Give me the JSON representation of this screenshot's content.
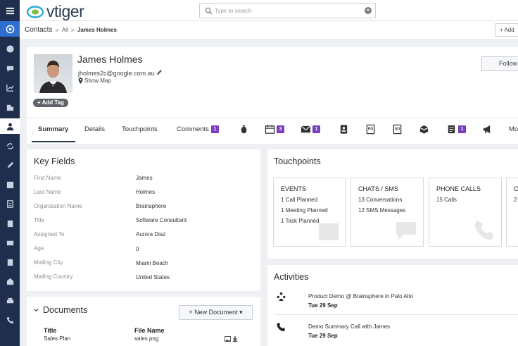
{
  "brand": {
    "name": "vtiger"
  },
  "search": {
    "placeholder": "Type to search"
  },
  "breadcrumb": {
    "module": "Contacts",
    "sep1": ">",
    "list": "All",
    "sep2": ">",
    "record": "James Holmes"
  },
  "toolbar": {
    "add_label": "+ Add"
  },
  "record": {
    "name": "James Holmes",
    "email": "jholmes2c@google.com.au",
    "show_map": "Show Map",
    "add_tag": "+ Add Tag",
    "follow": "Follow"
  },
  "tabs": [
    {
      "label": "Summary",
      "active": true
    },
    {
      "label": "Details"
    },
    {
      "label": "Touchpoints"
    },
    {
      "label": "Comments",
      "badge": "1"
    }
  ],
  "tab_icons": [
    {
      "icon": "money-bag-icon"
    },
    {
      "icon": "calendar-icon",
      "badge": "3"
    },
    {
      "icon": "envelope-icon",
      "badge": "1"
    },
    {
      "icon": "contact-card-icon"
    },
    {
      "icon": "purchase-order-icon",
      "text": "PO"
    },
    {
      "icon": "sales-order-icon",
      "text": "SO"
    },
    {
      "icon": "box-icon"
    },
    {
      "icon": "document-icon",
      "badge": "1"
    },
    {
      "icon": "megaphone-icon"
    }
  ],
  "more_tab": "Mo",
  "key_fields": {
    "title": "Key Fields",
    "rows": [
      {
        "label": "First Name",
        "value": "James"
      },
      {
        "label": "Last Name",
        "value": "Holmes"
      },
      {
        "label": "Organization Name",
        "value": "Brainsphere"
      },
      {
        "label": "Title",
        "value": "Software Consultant"
      },
      {
        "label": "Assigned To",
        "value": "Aurora Diaz"
      },
      {
        "label": "Age",
        "value": "0"
      },
      {
        "label": "Mailing City",
        "value": "Miami Beach"
      },
      {
        "label": "Mailing Country",
        "value": "United States"
      }
    ]
  },
  "touchpoints": {
    "title": "Touchpoints",
    "cards": [
      {
        "head": "EVENTS",
        "rows": [
          "1 Call Planned",
          "1 Meeting Planned",
          "1 Task Planned"
        ]
      },
      {
        "head": "CHATS / SMS",
        "rows": [
          "13  Conversations",
          "12  SMS Messages"
        ]
      },
      {
        "head": "PHONE CALLS",
        "rows": [
          "15  Calls"
        ]
      },
      {
        "head": "C",
        "rows": [
          "2"
        ]
      }
    ]
  },
  "activities": {
    "title": "Activities",
    "items": [
      {
        "icon": "meeting-icon",
        "title": "Product Demo @ Brainsphere in Palo Alto",
        "date": "Tue 29 Sep"
      },
      {
        "icon": "phone-icon",
        "title": "Demo Summary Call with James",
        "date": "Tue 29 Sep"
      }
    ]
  },
  "documents": {
    "title": "Documents",
    "new_label": "+ New Document ▾",
    "col_title": "Title",
    "col_file": "File Name",
    "row_title": "Sales Plan",
    "row_file": "sales.png"
  },
  "colors": {
    "rail": "#1f2e4c",
    "accent": "#2f6fd1",
    "badge": "#7a3ebd"
  }
}
